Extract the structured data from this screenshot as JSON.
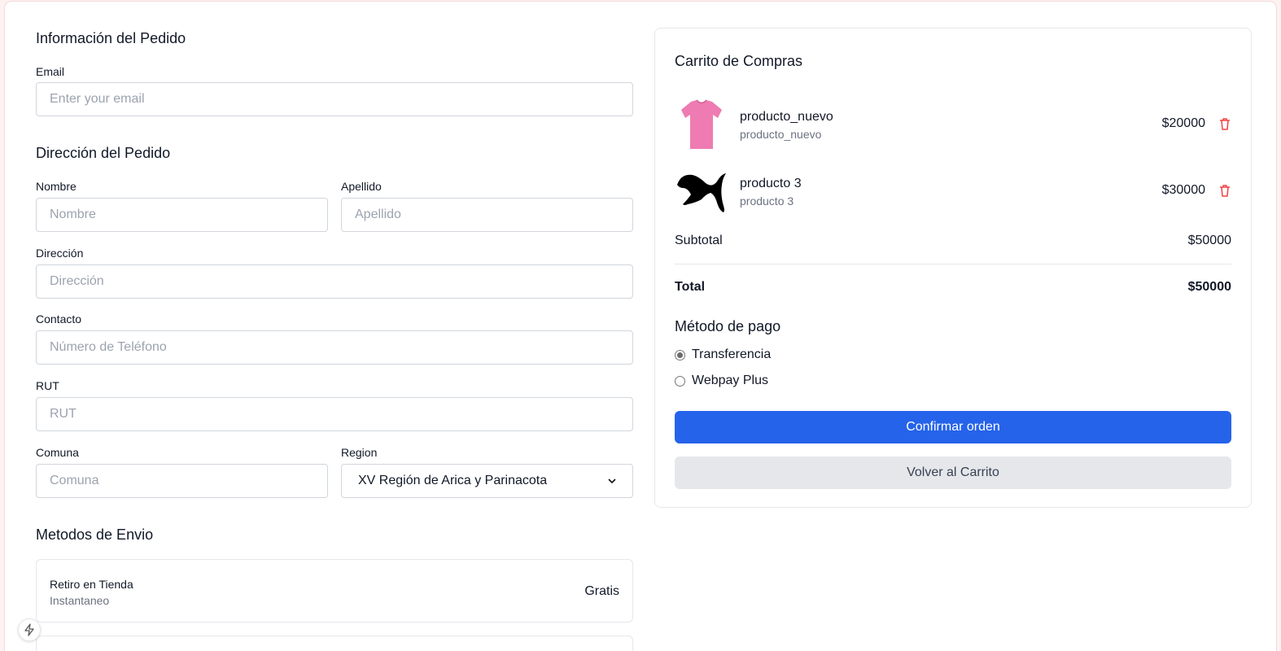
{
  "order_info": {
    "title": "Información del Pedido",
    "email_label": "Email",
    "email_placeholder": "Enter your email",
    "email_value": ""
  },
  "address": {
    "title": "Dirección del Pedido",
    "first_name_label": "Nombre",
    "first_name_placeholder": "Nombre",
    "last_name_label": "Apellido",
    "last_name_placeholder": "Apellido",
    "address_label": "Dirección",
    "address_placeholder": "Dirección",
    "contact_label": "Contacto",
    "contact_placeholder": "Número de Teléfono",
    "rut_label": "RUT",
    "rut_placeholder": "RUT",
    "comuna_label": "Comuna",
    "comuna_placeholder": "Comuna",
    "region_label": "Region",
    "region_selected": "XV Región de Arica y Parinacota"
  },
  "shipping": {
    "title": "Metodos de Envio",
    "methods": [
      {
        "name": "Retiro en Tienda",
        "detail": "Instantaneo",
        "price": "Gratis"
      }
    ]
  },
  "cart": {
    "title": "Carrito de Compras",
    "items": [
      {
        "name": "producto_nuevo",
        "subtitle": "producto_nuevo",
        "price": "$20000",
        "thumb_icon": "pink-tshirt-image"
      },
      {
        "name": "producto 3",
        "subtitle": "producto 3",
        "price": "$30000",
        "thumb_icon": "puma-logo-image"
      }
    ],
    "subtotal_label": "Subtotal",
    "subtotal_value": "$50000",
    "total_label": "Total",
    "total_value": "$50000"
  },
  "payment": {
    "title": "Método de pago",
    "options": [
      {
        "label": "Transferencia",
        "selected": true
      },
      {
        "label": "Webpay Plus",
        "selected": false
      }
    ]
  },
  "actions": {
    "confirm_label": "Confirmar orden",
    "back_label": "Volver al Carrito"
  },
  "colors": {
    "primary": "#2563eb",
    "danger": "#ef4444",
    "secondary_bg": "#e5e7eb"
  }
}
